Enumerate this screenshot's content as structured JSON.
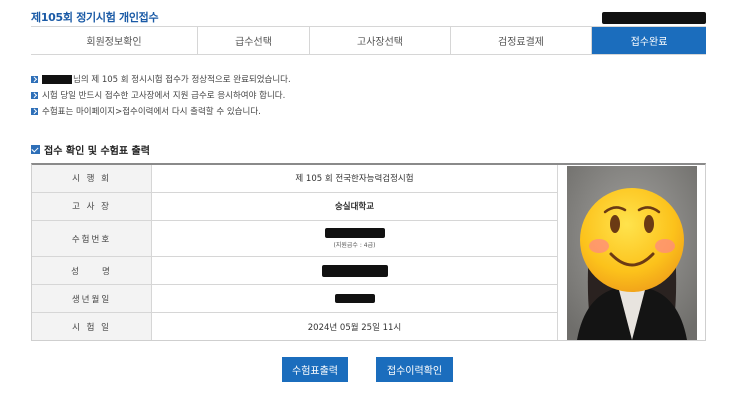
{
  "header": {
    "title": "제105회 정기시험 개인접수"
  },
  "steps": [
    {
      "label": "회원정보확인",
      "active": false
    },
    {
      "label": "급수선택",
      "active": false
    },
    {
      "label": "고사장선택",
      "active": false
    },
    {
      "label": "검정료결제",
      "active": false
    },
    {
      "label": "접수완료",
      "active": true
    }
  ],
  "notices": [
    {
      "text": "님의 제 105 회 정시시험 접수가 정상적으로 완료되었습니다."
    },
    {
      "text": "시험 당일 반드시 접수한 고사장에서 지원 급수로 응시하여야 합니다."
    },
    {
      "text": "수험표는 마이페이지>접수이력에서 다시 출력할 수 있습니다."
    }
  ],
  "section": {
    "title": "접수 확인 및 수험표 출력"
  },
  "table": {
    "exam_round_label": "시 행 회",
    "exam_round_value": "제 105 회 전국한자능력검정시험",
    "venue_label": "고 사 장",
    "venue_value": "숭실대학교",
    "exam_number_label": "수험번호",
    "exam_number_note": "(지원급수 : 4급)",
    "name_label": "성　　명",
    "birth_label": "생년월일",
    "exam_date_label": "시 험 일",
    "exam_date_value": "2024년 05월 25일 11시"
  },
  "buttons": {
    "print_ticket": "수험표출력",
    "check_history": "접수이력확인"
  },
  "colors": {
    "accent": "#1b6dbd",
    "title": "#1a5aa6"
  }
}
